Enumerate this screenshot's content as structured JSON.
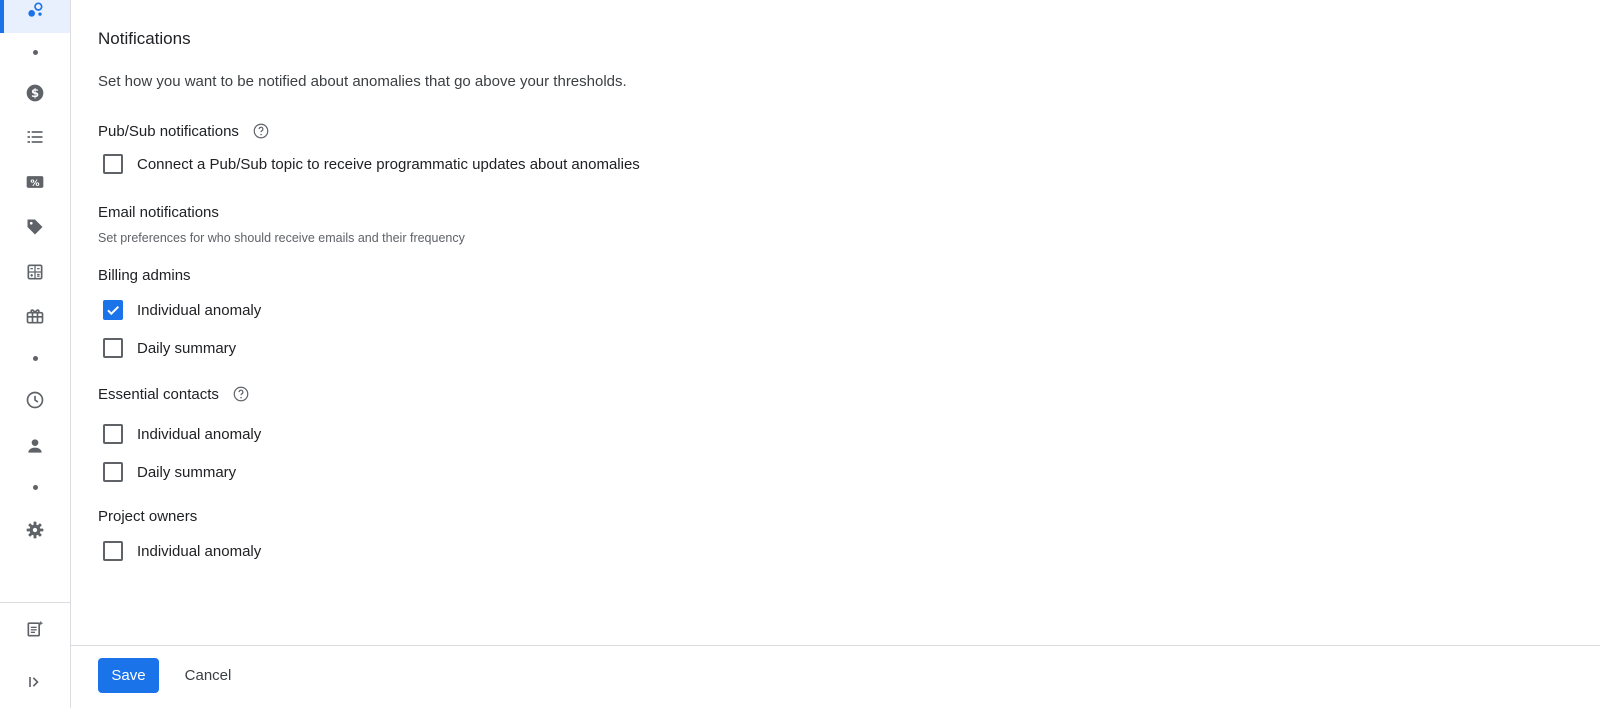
{
  "sidebar": {
    "icons": [
      "analytics-icon",
      "dollar-icon",
      "list-icon",
      "percent-icon",
      "tag-icon",
      "calculator-icon",
      "gift-icon",
      "clock-icon",
      "person-icon",
      "gear-icon",
      "notes-icon",
      "expand-icon"
    ]
  },
  "notifications": {
    "title": "Notifications",
    "description": "Set how you want to be notified about anomalies that go above your thresholds.",
    "pubsub": {
      "heading": "Pub/Sub notifications",
      "option": {
        "label": "Connect a Pub/Sub topic to receive programmatic updates about anomalies",
        "checked": false
      }
    },
    "email": {
      "heading": "Email notifications",
      "subtext": "Set preferences for who should receive emails and their frequency",
      "billing_admins": {
        "label": "Billing admins",
        "options": [
          {
            "label": "Individual anomaly",
            "checked": true
          },
          {
            "label": "Daily summary",
            "checked": false
          }
        ]
      },
      "essential_contacts": {
        "label": "Essential contacts",
        "options": [
          {
            "label": "Individual anomaly",
            "checked": false
          },
          {
            "label": "Daily summary",
            "checked": false
          }
        ]
      },
      "project_owners": {
        "label": "Project owners",
        "options": [
          {
            "label": "Individual anomaly",
            "checked": false
          }
        ]
      }
    }
  },
  "footer": {
    "save_label": "Save",
    "cancel_label": "Cancel"
  },
  "colors": {
    "accent": "#1a73e8",
    "icon": "#5f6368",
    "active_bg": "#e8f0fe"
  }
}
